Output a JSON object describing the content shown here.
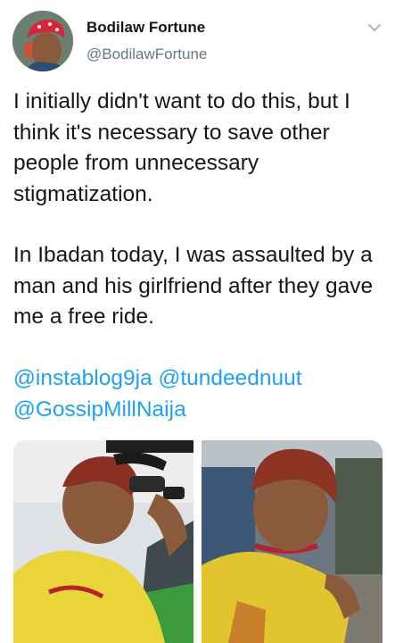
{
  "tweet": {
    "display_name": "Bodilaw Fortune",
    "handle": "@BodilawFortune",
    "paragraph_1": "I initially didn't want to do this, but I think it's necessary to save other people from unnecessary stigmatization.",
    "paragraph_2": "In Ibadan today, I was assaulted by a man and his girlfriend after they gave me a free ride.",
    "mentions": [
      "@instablog9ja",
      "@tundeednuut",
      "@GossipMillNaija"
    ]
  },
  "icons": {
    "menu": "chevron-down-icon"
  },
  "colors": {
    "text": "#14171a",
    "secondary_text": "#657786",
    "link": "#1da1f2",
    "avatar_headscarf": "#d6253a"
  }
}
